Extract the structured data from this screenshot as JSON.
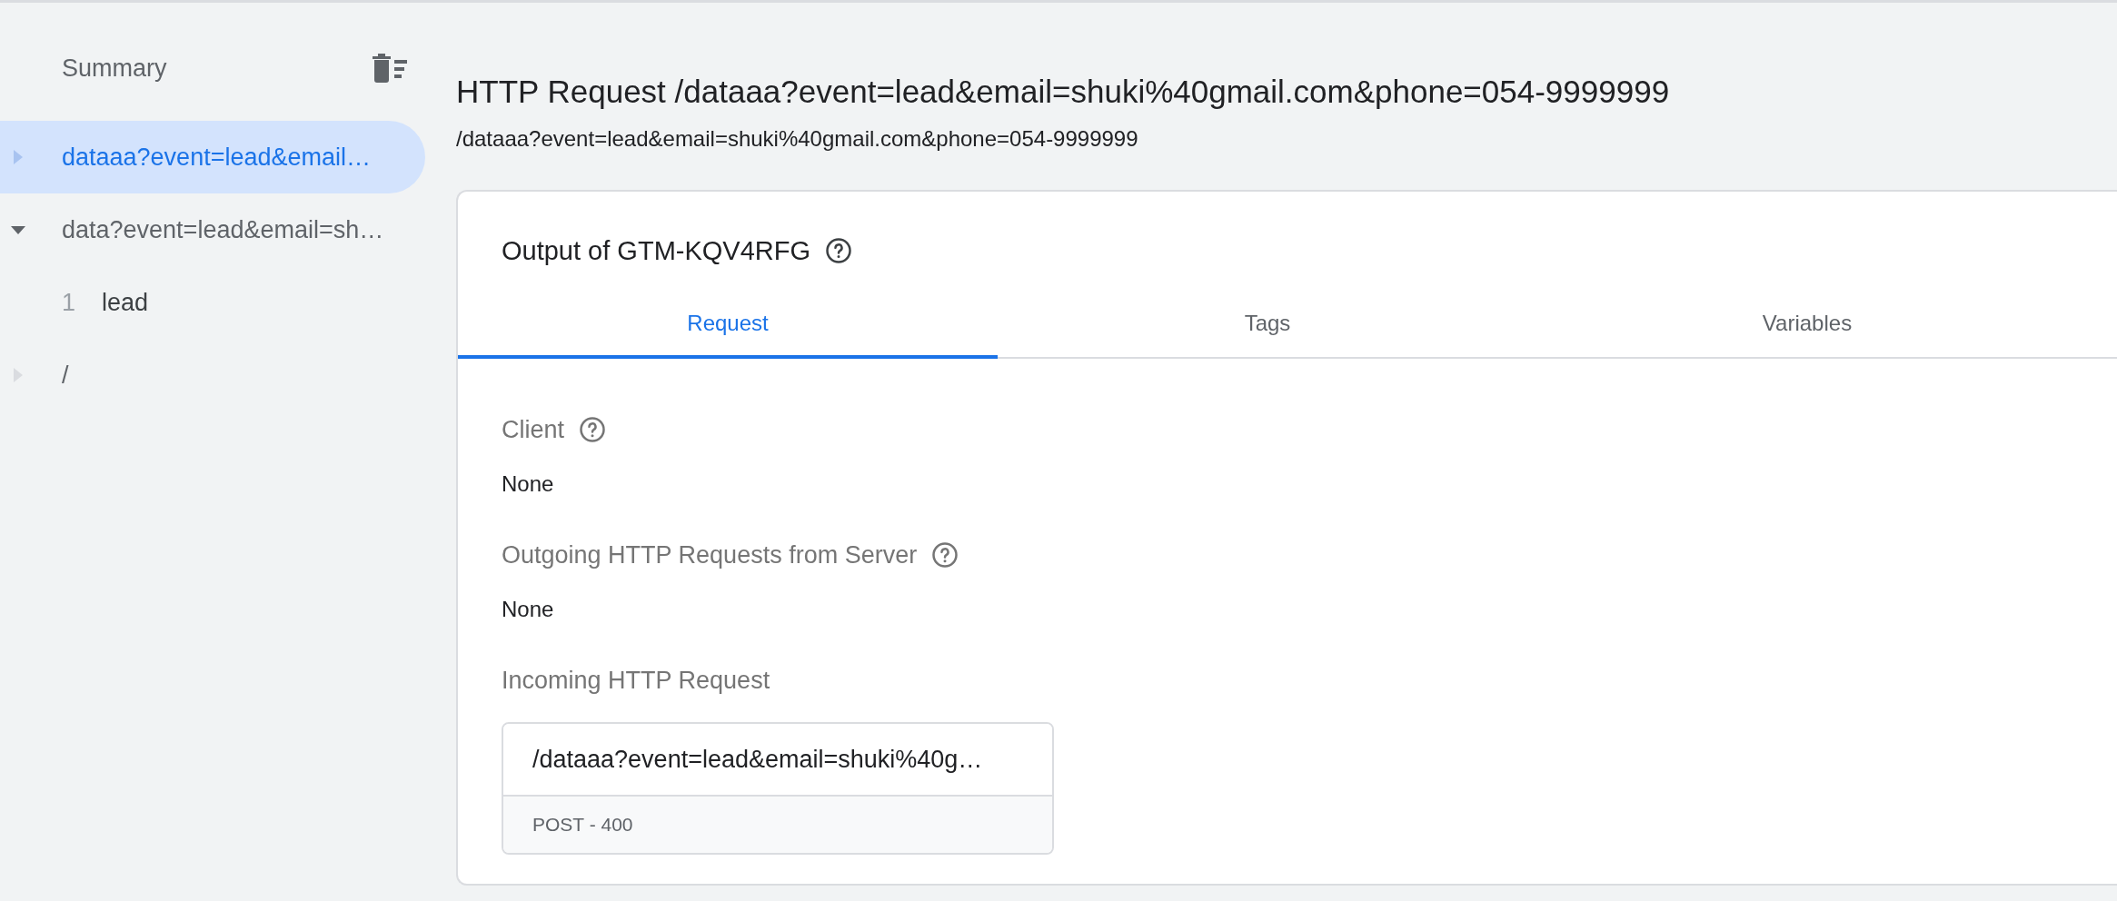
{
  "sidebar": {
    "title": "Summary",
    "items": [
      {
        "label": "dataaa?event=lead&email…",
        "selected": true,
        "expanded": false
      },
      {
        "label": "data?event=lead&email=sh…",
        "selected": false,
        "expanded": true,
        "children": [
          {
            "number": "1",
            "label": "lead",
            "selected": false
          }
        ]
      },
      {
        "label": "/",
        "selected": false,
        "expanded": false
      }
    ]
  },
  "header": {
    "title": "HTTP Request /dataaa?event=lead&email=shuki%40gmail.com&phone=054-9999999",
    "subtitle": "/dataaa?event=lead&email=shuki%40gmail.com&phone=054-9999999"
  },
  "card": {
    "title": "Output of GTM-KQV4RFG",
    "tabs": [
      {
        "label": "Request",
        "selected": true
      },
      {
        "label": "Tags",
        "selected": false
      },
      {
        "label": "Variables",
        "selected": false
      }
    ],
    "sections": [
      {
        "kind": "text",
        "label": "Client",
        "help": true,
        "value": "None"
      },
      {
        "kind": "text",
        "label": "Outgoing HTTP Requests from Server",
        "help": true,
        "value": "None"
      },
      {
        "kind": "request",
        "label": "Incoming HTTP Request",
        "help": false,
        "url": "/dataaa?event=lead&email=shuki%40g…",
        "status": "POST - 400"
      }
    ]
  }
}
